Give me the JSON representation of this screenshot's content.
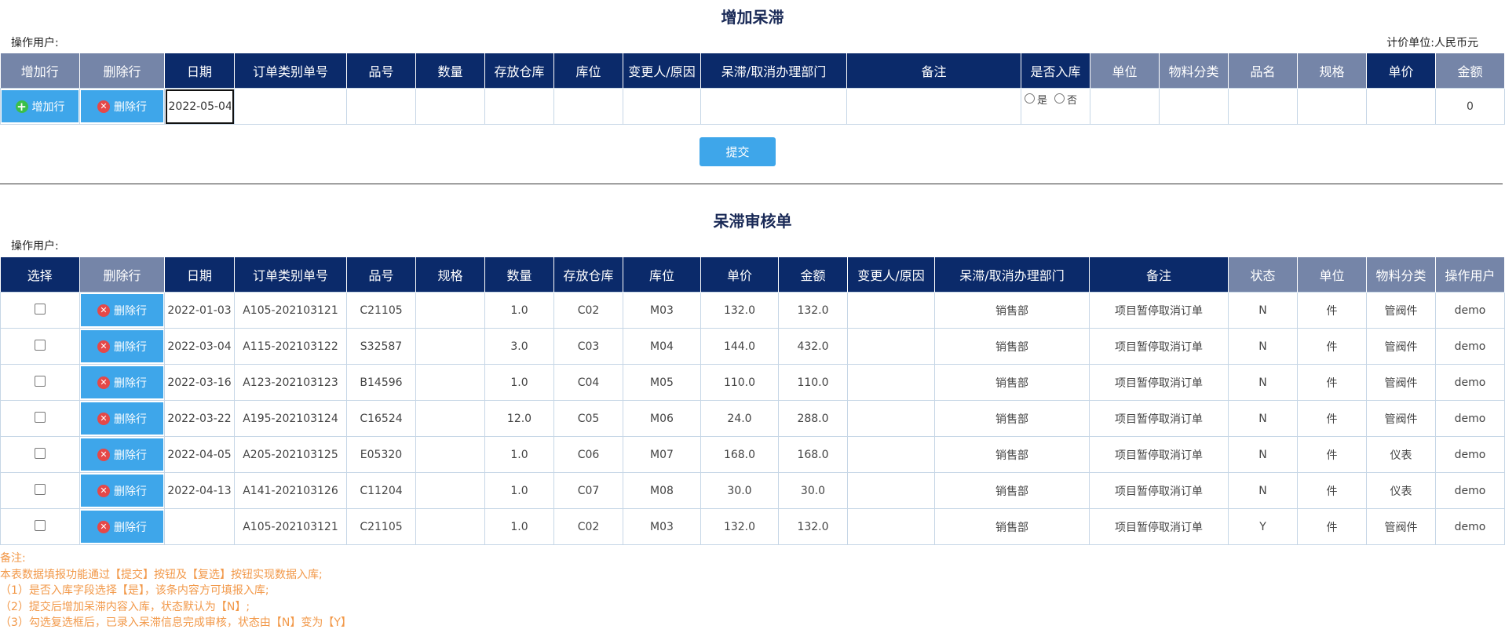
{
  "add_form": {
    "title": "增加呆滞",
    "operator_label": "操作用户:",
    "currency_label": "计价单位:",
    "currency_value": "人民币元",
    "headers": [
      "增加行",
      "删除行",
      "日期",
      "订单类别单号",
      "品号",
      "数量",
      "存放仓库",
      "库位",
      "变更人/原因",
      "呆滞/取消办理部门",
      "备注",
      "是否入库",
      "单位",
      "物料分类",
      "品名",
      "规格",
      "单价",
      "金额"
    ],
    "add_row_label": "增加行",
    "delete_row_label": "删除行",
    "date_value": "2022-05-04",
    "radio_yes": "是",
    "radio_no": "否",
    "amount_value": "0",
    "submit_label": "提交"
  },
  "review": {
    "title": "呆滞审核单",
    "operator_label": "操作用户:",
    "headers": [
      "选择",
      "删除行",
      "日期",
      "订单类别单号",
      "品号",
      "规格",
      "数量",
      "存放仓库",
      "库位",
      "单价",
      "金额",
      "变更人/原因",
      "呆滞/取消办理部门",
      "备注",
      "状态",
      "单位",
      "物料分类",
      "操作用户"
    ],
    "delete_row_label": "删除行",
    "rows": [
      {
        "date": "2022-01-03",
        "order": "A105-202103121",
        "part": "C21105",
        "spec": "",
        "qty": "1.0",
        "warehouse": "C02",
        "location": "M03",
        "price": "132.0",
        "amount": "132.0",
        "changer": "",
        "dept": "销售部",
        "note": "项目暂停取消订单",
        "status": "N",
        "unit": "件",
        "category": "管阀件",
        "user": "demo"
      },
      {
        "date": "2022-03-04",
        "order": "A115-202103122",
        "part": "S32587",
        "spec": "",
        "qty": "3.0",
        "warehouse": "C03",
        "location": "M04",
        "price": "144.0",
        "amount": "432.0",
        "changer": "",
        "dept": "销售部",
        "note": "项目暂停取消订单",
        "status": "N",
        "unit": "件",
        "category": "管阀件",
        "user": "demo"
      },
      {
        "date": "2022-03-16",
        "order": "A123-202103123",
        "part": "B14596",
        "spec": "",
        "qty": "1.0",
        "warehouse": "C04",
        "location": "M05",
        "price": "110.0",
        "amount": "110.0",
        "changer": "",
        "dept": "销售部",
        "note": "项目暂停取消订单",
        "status": "N",
        "unit": "件",
        "category": "管阀件",
        "user": "demo"
      },
      {
        "date": "2022-03-22",
        "order": "A195-202103124",
        "part": "C16524",
        "spec": "",
        "qty": "12.0",
        "warehouse": "C05",
        "location": "M06",
        "price": "24.0",
        "amount": "288.0",
        "changer": "",
        "dept": "销售部",
        "note": "项目暂停取消订单",
        "status": "N",
        "unit": "件",
        "category": "管阀件",
        "user": "demo"
      },
      {
        "date": "2022-04-05",
        "order": "A205-202103125",
        "part": "E05320",
        "spec": "",
        "qty": "1.0",
        "warehouse": "C06",
        "location": "M07",
        "price": "168.0",
        "amount": "168.0",
        "changer": "",
        "dept": "销售部",
        "note": "项目暂停取消订单",
        "status": "N",
        "unit": "件",
        "category": "仪表",
        "user": "demo"
      },
      {
        "date": "2022-04-13",
        "order": "A141-202103126",
        "part": "C11204",
        "spec": "",
        "qty": "1.0",
        "warehouse": "C07",
        "location": "M08",
        "price": "30.0",
        "amount": "30.0",
        "changer": "",
        "dept": "销售部",
        "note": "项目暂停取消订单",
        "status": "N",
        "unit": "件",
        "category": "仪表",
        "user": "demo"
      },
      {
        "date": "",
        "order": "A105-202103121",
        "part": "C21105",
        "spec": "",
        "qty": "1.0",
        "warehouse": "C02",
        "location": "M03",
        "price": "132.0",
        "amount": "132.0",
        "changer": "",
        "dept": "销售部",
        "note": "项目暂停取消订单",
        "status": "Y",
        "unit": "件",
        "category": "管阀件",
        "user": "demo"
      }
    ]
  },
  "notes": [
    "备注:",
    "本表数据填报功能通过【提交】按钮及【复选】按钮实现数据入库;",
    "（1）是否入库字段选择【是】，该条内容方可填报入库;",
    "（2）提交后增加呆滞内容入库，状态默认为【N】;",
    "（3）勾选复选框后，已录入呆滞信息完成审核，状态由【N】变为【Y】"
  ],
  "colors": {
    "header_dark": "#0b2a6a",
    "header_light": "#7585a8",
    "button_blue": "#3ea6ea",
    "note_orange": "#f2994a"
  }
}
